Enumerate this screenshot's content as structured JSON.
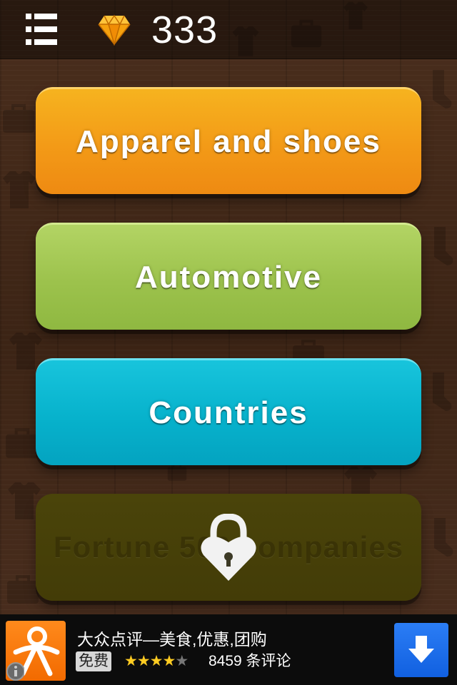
{
  "header": {
    "menu_icon": "list-menu-icon",
    "gem_icon": "diamond-icon",
    "gem_count": "333"
  },
  "categories": [
    {
      "label": "Apparel and shoes",
      "locked": false,
      "color": "#f39a17"
    },
    {
      "label": "Automotive",
      "locked": false,
      "color": "#9cc24c"
    },
    {
      "label": "Countries",
      "locked": false,
      "color": "#07b2cc"
    },
    {
      "label": "Fortune 500 companies",
      "locked": true,
      "color": "#433c07",
      "lock_icon": "heart-padlock-icon"
    }
  ],
  "ad": {
    "title": "大众点评—美食,优惠,团购",
    "badge": "免费",
    "rating": 4,
    "rating_max": 5,
    "stars_text_on": "★★★★",
    "stars_text_off": "★",
    "reviews": "8459 条评论",
    "download_icon": "download-arrow-icon",
    "info_icon": "info-icon",
    "accent_color": "#1160e0"
  }
}
